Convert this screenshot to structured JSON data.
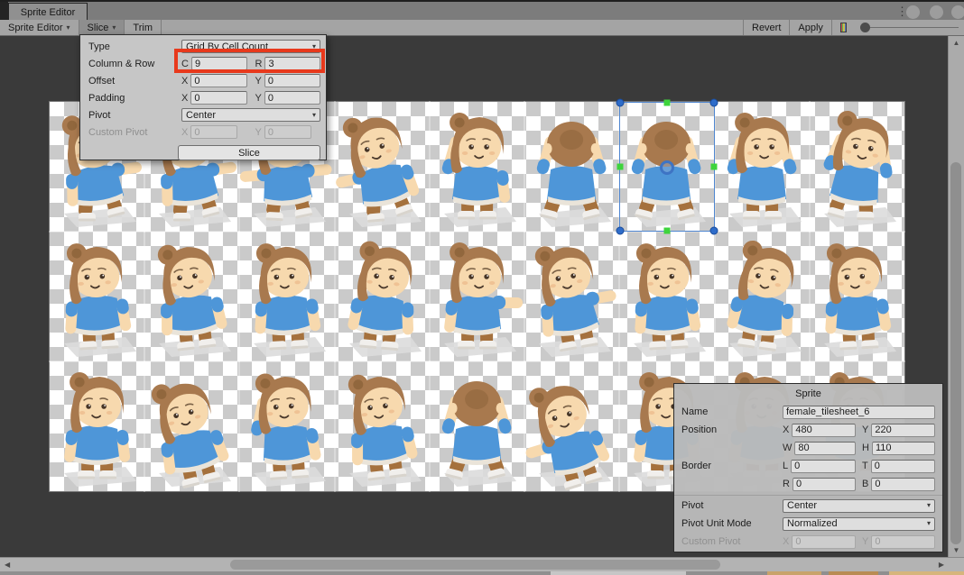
{
  "titlebar": {
    "tab_label": "Sprite Editor"
  },
  "icons": {
    "dropdown_arrow": "▾",
    "menu_dots": "⋮",
    "scroll_up": "▲",
    "scroll_down": "▼",
    "scroll_left": "◀",
    "scroll_right": "▶"
  },
  "toolbar": {
    "sprite_editor_label": "Sprite Editor",
    "slice_label": "Slice",
    "trim_label": "Trim",
    "revert_label": "Revert",
    "apply_label": "Apply"
  },
  "slice_panel": {
    "type_label": "Type",
    "type_value": "Grid By Cell Count",
    "colrow_label": "Column & Row",
    "c_prefix": "C",
    "c_value": "9",
    "r_prefix": "R",
    "r_value": "3",
    "offset_label": "Offset",
    "x_prefix": "X",
    "y_prefix": "Y",
    "offset_x": "0",
    "offset_y": "0",
    "padding_label": "Padding",
    "padding_x": "0",
    "padding_y": "0",
    "pivot_label": "Pivot",
    "pivot_value": "Center",
    "custom_pivot_label": "Custom Pivot",
    "custom_x": "0",
    "custom_y": "0",
    "slice_action": "Slice",
    "highlight_color": "#e8391c"
  },
  "sprite_panel": {
    "title": "Sprite",
    "name_label": "Name",
    "name_value": "female_tilesheet_6",
    "position_label": "Position",
    "x_prefix": "X",
    "x_value": "480",
    "y_prefix": "Y",
    "y_value": "220",
    "w_prefix": "W",
    "w_value": "80",
    "h_prefix": "H",
    "h_value": "110",
    "border_label": "Border",
    "l_prefix": "L",
    "l_value": "0",
    "t_prefix": "T",
    "t_value": "0",
    "r_prefix": "R",
    "r_value": "0",
    "b_prefix": "B",
    "b_value": "0",
    "pivot_label": "Pivot",
    "pivot_value": "Center",
    "pivot_unit_mode_label": "Pivot Unit Mode",
    "pivot_unit_mode_value": "Normalized",
    "custom_pivot_label": "Custom Pivot",
    "custom_x": "0",
    "custom_y": "0"
  },
  "canvas": {
    "checker_light": "#ffffff",
    "checker_dark": "#cacaca"
  },
  "sprite_grid": {
    "columns": 9,
    "rows": 3,
    "selected": {
      "row": 0,
      "col": 6
    },
    "palette": {
      "hair": "#a8794e",
      "hairDark": "#8a6138",
      "skin": "#f7d9ae",
      "shirt": "#4e96d8",
      "pants": "#a5713d",
      "shoe": "#f1efec",
      "shadow": "#dcdcdc"
    },
    "cells": [
      "walkL",
      "walkL",
      "armsOut",
      "walkL2",
      "startled",
      "back",
      "back",
      "cheer",
      "cheerTilt",
      "standL",
      "leanL",
      "standL",
      "leanR",
      "point",
      "leanL2",
      "standL",
      "leanR2",
      "standL",
      "stand",
      "bend",
      "wave",
      "leanL",
      "back",
      "bendL",
      "stand",
      "stand",
      "stand"
    ]
  },
  "selection_colors": {
    "border": "#4f86d0",
    "handle_corner": "#2e6cc9",
    "handle_mid": "#3ed43c"
  }
}
